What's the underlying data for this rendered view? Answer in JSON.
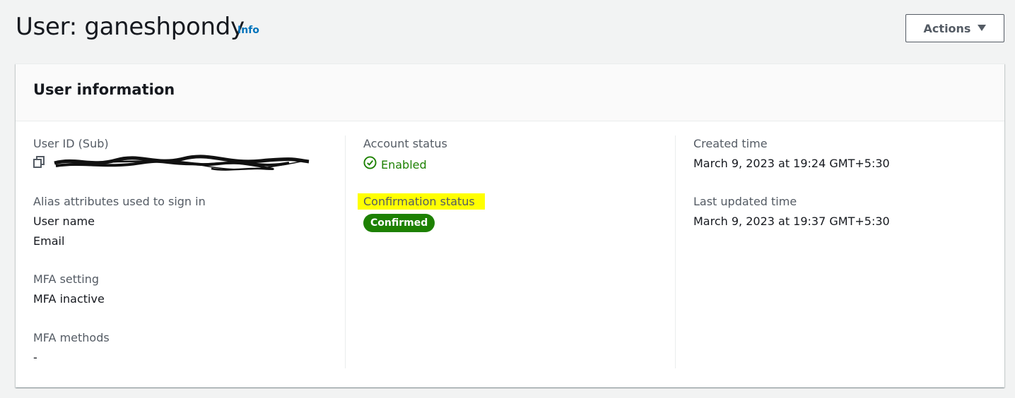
{
  "header": {
    "title": "User: ganeshpondy",
    "info_link": "Info",
    "actions_label": "Actions",
    "actions_icon": "caret-down-icon"
  },
  "panel": {
    "title": "User information",
    "col1": {
      "user_id_label": "User ID (Sub)",
      "user_id_icon": "copy-icon",
      "alias_label": "Alias attributes used to sign in",
      "alias_values": [
        "User name",
        "Email"
      ],
      "mfa_setting_label": "MFA setting",
      "mfa_setting_value": "MFA inactive",
      "mfa_methods_label": "MFA methods",
      "mfa_methods_value": "-"
    },
    "col2": {
      "account_status_label": "Account status",
      "account_status_value": "Enabled",
      "account_status_icon": "check-circle-icon",
      "confirmation_label": "Confirmation status",
      "confirmation_value": "Confirmed"
    },
    "col3": {
      "created_label": "Created time",
      "created_value": "March 9, 2023 at 19:24 GMT+5:30",
      "updated_label": "Last updated time",
      "updated_value": "March 9, 2023 at 19:37 GMT+5:30"
    }
  },
  "colors": {
    "background": "#f2f3f3",
    "success_green": "#1d8102",
    "link_blue": "#0073bb",
    "highlight_yellow": "#ffff00"
  }
}
